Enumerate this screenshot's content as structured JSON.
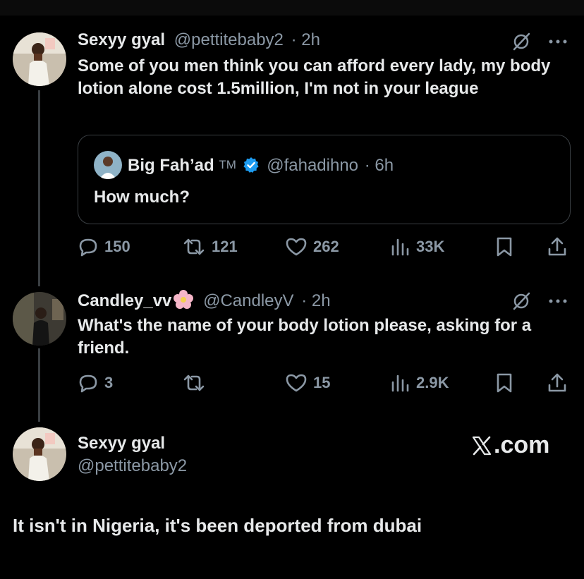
{
  "tweet1": {
    "name": "Sexyy gyal",
    "handle": "@pettitebaby2",
    "time": "· 2h",
    "text": "Some of you men think you can afford every lady, my body lotion alone cost 1.5million, I'm not in your league",
    "quote": {
      "name": "Big Fah’ad",
      "tm": "TM",
      "handle": "@fahadihno",
      "time": "· 6h",
      "text": "How much?"
    },
    "replies": "150",
    "reposts": "121",
    "likes": "262",
    "views": "33K"
  },
  "tweet2": {
    "name": "Candley_vv",
    "handle": "@CandleyV",
    "time": "· 2h",
    "text": "What's the name of your body lotion please, asking for a friend.",
    "replies": "3",
    "reposts": "",
    "likes": "15",
    "views": "2.9K"
  },
  "card": {
    "name": "Sexyy gyal",
    "handle": "@pettitebaby2",
    "brand": ".com",
    "reply": "It isn't in Nigeria, it's been deported from dubai"
  },
  "colors": {
    "background": "#000000",
    "text": "#e7e9ea",
    "muted": "#8b98a5",
    "verified": "#1d9bf0",
    "border": "#3a3f43"
  },
  "icons": [
    "grok-slash-icon",
    "more-icon",
    "reply-icon",
    "repost-icon",
    "like-icon",
    "views-icon",
    "bookmark-icon",
    "share-icon",
    "verified-badge-icon",
    "flower-emoji"
  ]
}
